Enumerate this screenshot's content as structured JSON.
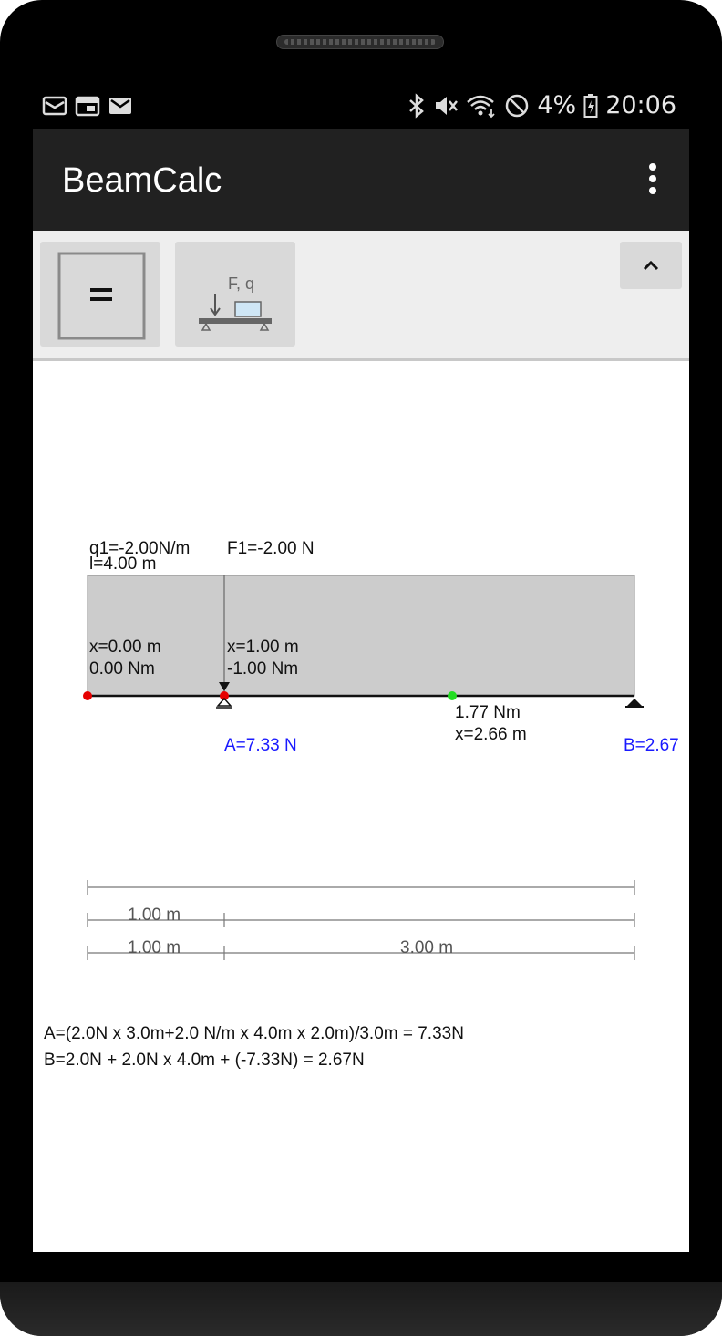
{
  "status_bar": {
    "battery_percent": "4%",
    "time": "20:06",
    "left_icons": [
      "mail-icon",
      "calendar-icon",
      "mail-icon"
    ],
    "right_icons": [
      "bluetooth-icon",
      "vibrate-icon",
      "wifi-icon",
      "blocked-icon",
      "battery-icon"
    ]
  },
  "app_bar": {
    "title": "BeamCalc",
    "menu_icon": "overflow-menu-icon"
  },
  "toolbar": {
    "calculate_icon": "equals-icon",
    "load_button_label": "F, q",
    "collapse_icon": "chevron-up-icon"
  },
  "beam": {
    "load_label": "q1=-2.00N/m",
    "length_label": "l=4.00 m",
    "force_label": "F1=-2.00 N",
    "moment_points": [
      {
        "x_label": "x=0.00 m",
        "moment_label": "0.00 Nm"
      },
      {
        "x_label": "x=1.00 m",
        "moment_label": "-1.00 Nm"
      }
    ],
    "max_moment": {
      "moment_label": "1.77 Nm",
      "x_label": "x=2.66 m"
    },
    "reactions": {
      "A": "A=7.33 N",
      "B": "B=2.67"
    },
    "dimensions": {
      "row2": [
        "1.00 m"
      ],
      "row3": [
        "1.00 m",
        "3.00 m"
      ]
    },
    "colors": {
      "moment_fill": "#cccccc",
      "reaction_text": "#1a1aff",
      "point_red": "#e60000",
      "point_green": "#22dd22"
    }
  },
  "formulas": {
    "A": "A=(2.0N x 3.0m+2.0 N/m x 4.0m x 2.0m)/3.0m = 7.33N",
    "B": "B=2.0N + 2.0N x 4.0m + (-7.33N) = 2.67N"
  }
}
